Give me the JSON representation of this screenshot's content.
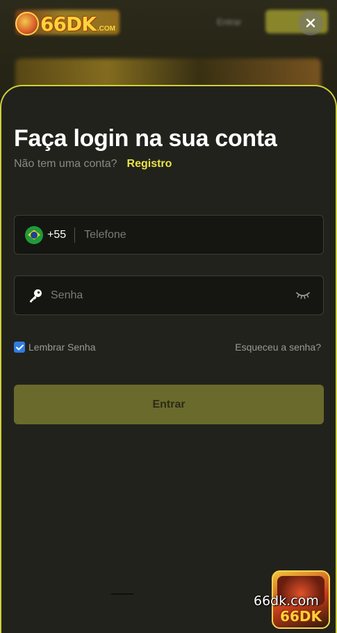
{
  "header": {
    "logo_text": "66DK",
    "logo_suffix": ".COM",
    "bg_login_label": "Entrar"
  },
  "modal": {
    "title": "Faça login na sua conta",
    "no_account_text": "Não tem uma conta?",
    "register_link": "Registro",
    "phone": {
      "dial_code": "+55",
      "placeholder": "Telefone",
      "value": ""
    },
    "password": {
      "placeholder": "Senha",
      "value": ""
    },
    "remember_label": "Lembrar Senha",
    "remember_checked": true,
    "forgot_label": "Esqueceu a senha?",
    "submit_label": "Entrar"
  },
  "badge": {
    "url_text": "66dk.com",
    "brand_text": "66DK"
  },
  "colors": {
    "accent": "#e8e24a",
    "sheet_bg": "#22221d",
    "submit_bg": "#6a6a2d",
    "checkbox": "#2f7de1"
  }
}
